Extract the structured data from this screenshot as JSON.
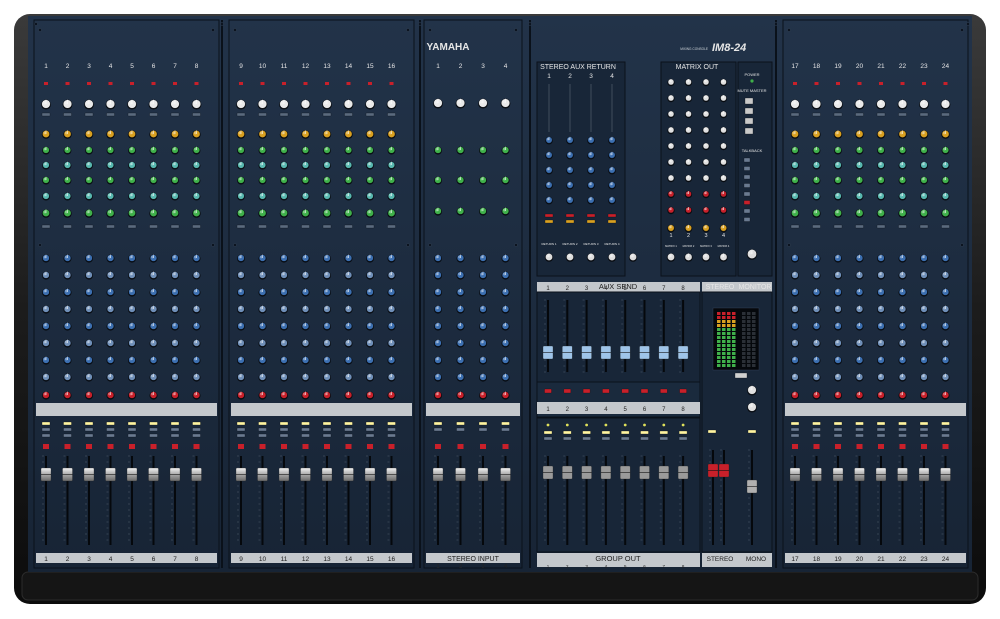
{
  "brand": "YAMAHA",
  "model": {
    "prefix": "MIXING CONSOLE",
    "name": "IM8-24"
  },
  "sections": {
    "stereo_aux_return": {
      "title": "STEREO AUX RETURN",
      "channels": [
        "1",
        "2",
        "3",
        "4"
      ],
      "return_labels": [
        "RETURN 1",
        "RETURN 2",
        "RETURN 3",
        "RETURN 4"
      ]
    },
    "matrix_out": {
      "title": "MATRIX OUT",
      "channels": [
        "1",
        "2",
        "3",
        "4"
      ],
      "matrix_labels": [
        "MATRIX 1",
        "MATRIX 2",
        "MATRIX 3",
        "MATRIX 4"
      ]
    },
    "aux_send": {
      "title": "AUX SEND",
      "channels": [
        "1",
        "2",
        "3",
        "4",
        "5",
        "6",
        "7",
        "8"
      ]
    },
    "stereo": {
      "title": "STEREO"
    },
    "monitor": {
      "title": "MONITOR"
    },
    "group_out": {
      "title": "GROUP OUT",
      "channels": [
        "1",
        "2",
        "3",
        "4",
        "5",
        "6",
        "7",
        "8"
      ]
    },
    "stereo_input": {
      "title": "STEREO INPUT",
      "channels": [
        "1",
        "2",
        "3",
        "4"
      ]
    },
    "master_bottom": {
      "stereo": "STEREO",
      "mono": "MONO"
    },
    "right_panel": {
      "power": "POWER",
      "mute_master": "MUTE MASTER",
      "talkback": "TALKBACK"
    }
  },
  "input_channels": {
    "bank1": [
      "1",
      "2",
      "3",
      "4",
      "5",
      "6",
      "7",
      "8"
    ],
    "bank2": [
      "9",
      "10",
      "11",
      "12",
      "13",
      "14",
      "15",
      "16"
    ],
    "bank3": [
      "17",
      "18",
      "19",
      "20",
      "21",
      "22",
      "23",
      "24"
    ]
  },
  "colors": {
    "panel": "#1c2b3d",
    "panel_dark": "#0f1826",
    "frame": "#1e1e1e",
    "silver": "#c4c8cc",
    "red": "#c8202a",
    "green": "#3fb04a",
    "yellow": "#d9a020",
    "blue": "#3c6fb0",
    "aqua": "#58b8b0"
  }
}
